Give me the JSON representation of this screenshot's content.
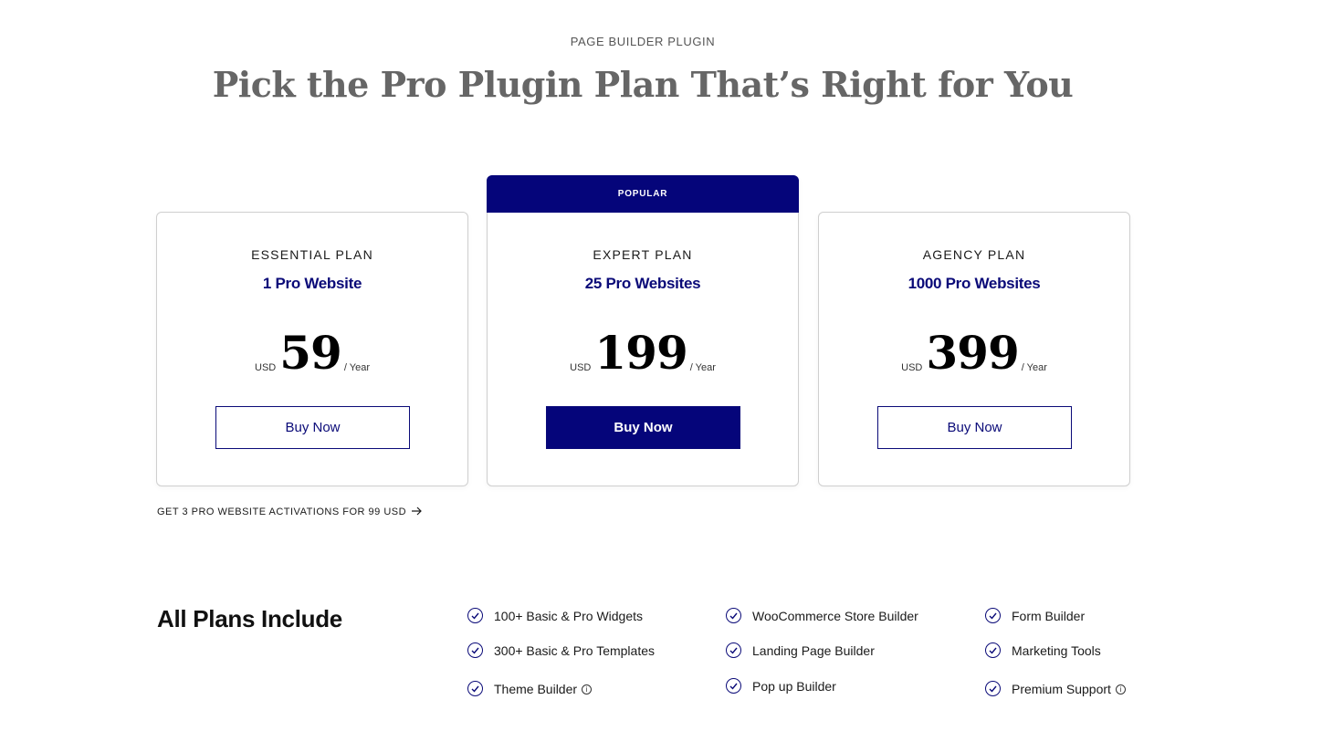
{
  "header": {
    "eyebrow": "PAGE BUILDER PLUGIN",
    "title": "Pick the Pro Plugin Plan That’s Right for You"
  },
  "plans": [
    {
      "name": "ESSENTIAL PLAN",
      "sites": "1 Pro Website",
      "currency": "USD",
      "price": "59",
      "period": "/ Year",
      "cta": "Buy Now"
    },
    {
      "badge": "POPULAR",
      "name": "EXPERT PLAN",
      "sites": "25 Pro Websites",
      "currency": "USD",
      "price": "199",
      "period": "/ Year",
      "cta": "Buy Now"
    },
    {
      "name": "AGENCY PLAN",
      "sites": "1000 Pro Websites",
      "currency": "USD",
      "price": "399",
      "period": "/ Year",
      "cta": "Buy Now"
    }
  ],
  "activation_link": {
    "label": "GET 3 PRO WEBSITE ACTIVATIONS FOR 99 USD",
    "icon": "arrow-right-icon"
  },
  "includes": {
    "title": "All Plans Include",
    "features": [
      {
        "label": "100+ Basic & Pro Widgets"
      },
      {
        "label": "300+ Basic & Pro Templates"
      },
      {
        "label": "Theme Builder",
        "info": true
      },
      {
        "label": "WooCommerce Store Builder"
      },
      {
        "label": "Landing Page Builder"
      },
      {
        "label": "Pop up Builder"
      },
      {
        "label": "Form Builder"
      },
      {
        "label": "Marketing Tools"
      },
      {
        "label": "Premium Support",
        "info": true
      }
    ]
  },
  "colors": {
    "accent": "#05057a",
    "heading": "#666666",
    "border": "#cfcfcf"
  }
}
